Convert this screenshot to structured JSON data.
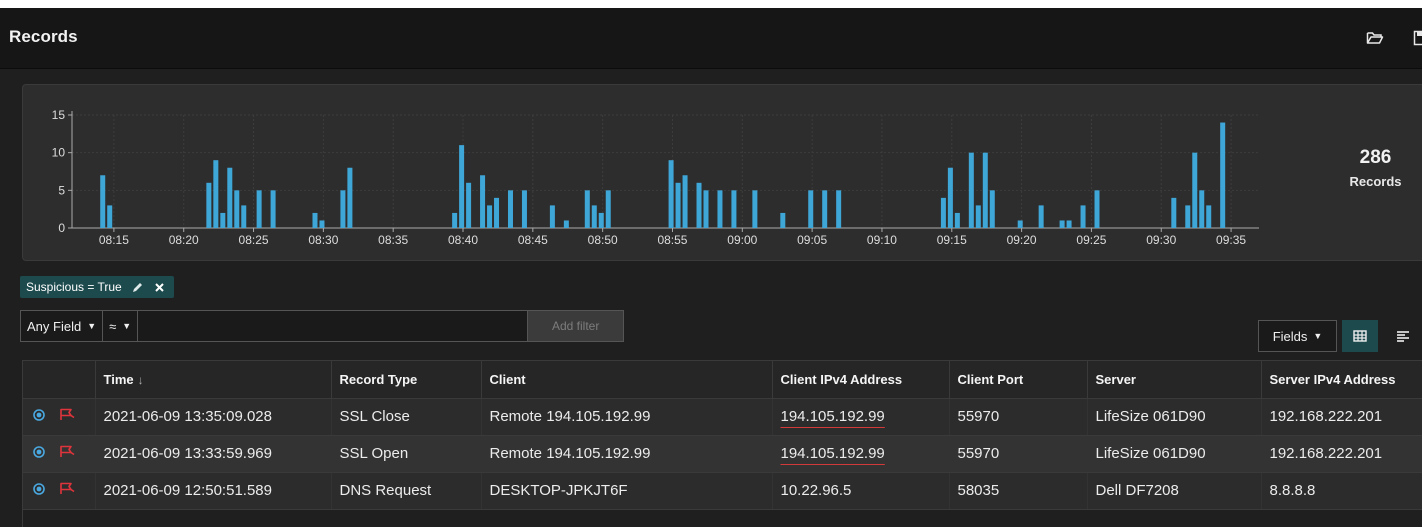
{
  "header": {
    "title": "Records",
    "icons": [
      "folder-open-icon",
      "save-icon"
    ]
  },
  "summary": {
    "count": "286",
    "label": "Records"
  },
  "chart_data": {
    "type": "bar",
    "ylim": [
      0,
      15
    ],
    "yticks": [
      "0",
      "5",
      "10",
      "15"
    ],
    "xticks": [
      "08:15",
      "08:20",
      "08:25",
      "08:30",
      "08:35",
      "08:40",
      "08:45",
      "08:50",
      "08:55",
      "09:00",
      "09:05",
      "09:10",
      "09:15",
      "09:20",
      "09:25",
      "09:30",
      "09:35"
    ],
    "x_unit": "minute",
    "x_start": "08:12",
    "x_end": "09:37",
    "bars": [
      {
        "t": "08:14.2",
        "v": 7
      },
      {
        "t": "08:14.7",
        "v": 3
      },
      {
        "t": "08:21.8",
        "v": 6
      },
      {
        "t": "08:22.3",
        "v": 9
      },
      {
        "t": "08:22.8",
        "v": 2
      },
      {
        "t": "08:23.3",
        "v": 8
      },
      {
        "t": "08:23.8",
        "v": 5
      },
      {
        "t": "08:24.3",
        "v": 3
      },
      {
        "t": "08:25.4",
        "v": 5
      },
      {
        "t": "08:26.4",
        "v": 5
      },
      {
        "t": "08:29.4",
        "v": 2
      },
      {
        "t": "08:29.9",
        "v": 1
      },
      {
        "t": "08:31.4",
        "v": 5
      },
      {
        "t": "08:31.9",
        "v": 8
      },
      {
        "t": "08:39.4",
        "v": 2
      },
      {
        "t": "08:39.9",
        "v": 11
      },
      {
        "t": "08:40.4",
        "v": 6
      },
      {
        "t": "08:41.4",
        "v": 7
      },
      {
        "t": "08:41.9",
        "v": 3
      },
      {
        "t": "08:42.4",
        "v": 4
      },
      {
        "t": "08:43.4",
        "v": 5
      },
      {
        "t": "08:44.4",
        "v": 5
      },
      {
        "t": "08:46.4",
        "v": 3
      },
      {
        "t": "08:47.4",
        "v": 1
      },
      {
        "t": "08:48.9",
        "v": 5
      },
      {
        "t": "08:49.4",
        "v": 3
      },
      {
        "t": "08:49.9",
        "v": 2
      },
      {
        "t": "08:50.4",
        "v": 5
      },
      {
        "t": "08:54.9",
        "v": 9
      },
      {
        "t": "08:55.4",
        "v": 6
      },
      {
        "t": "08:55.9",
        "v": 7
      },
      {
        "t": "08:56.9",
        "v": 6
      },
      {
        "t": "08:57.4",
        "v": 5
      },
      {
        "t": "08:58.4",
        "v": 5
      },
      {
        "t": "08:59.4",
        "v": 5
      },
      {
        "t": "09:00.9",
        "v": 5
      },
      {
        "t": "09:02.9",
        "v": 2
      },
      {
        "t": "09:04.9",
        "v": 5
      },
      {
        "t": "09:05.9",
        "v": 5
      },
      {
        "t": "09:06.9",
        "v": 5
      },
      {
        "t": "09:14.4",
        "v": 4
      },
      {
        "t": "09:14.9",
        "v": 8
      },
      {
        "t": "09:15.4",
        "v": 2
      },
      {
        "t": "09:16.4",
        "v": 10
      },
      {
        "t": "09:16.9",
        "v": 3
      },
      {
        "t": "09:17.4",
        "v": 10
      },
      {
        "t": "09:17.9",
        "v": 5
      },
      {
        "t": "09:19.9",
        "v": 1
      },
      {
        "t": "09:21.4",
        "v": 3
      },
      {
        "t": "09:22.9",
        "v": 1
      },
      {
        "t": "09:23.4",
        "v": 1
      },
      {
        "t": "09:24.4",
        "v": 3
      },
      {
        "t": "09:25.4",
        "v": 5
      },
      {
        "t": "09:30.9",
        "v": 4
      },
      {
        "t": "09:31.9",
        "v": 3
      },
      {
        "t": "09:32.4",
        "v": 10
      },
      {
        "t": "09:32.9",
        "v": 5
      },
      {
        "t": "09:33.4",
        "v": 3
      },
      {
        "t": "09:34.4",
        "v": 14
      }
    ],
    "bar_color": "#3fa6d8",
    "grid": true
  },
  "filter_tag": {
    "label": "Suspicious = True",
    "edit_icon": "pencil-icon",
    "remove_icon": "close-icon",
    "color": "#1d4a4d"
  },
  "filter_bar": {
    "field_select": "Any Field",
    "operator_select": "≈",
    "input_value": "",
    "add_button": "Add filter"
  },
  "toolbar": {
    "fields_button": "Fields",
    "grid_view_icon": "table-grid-icon",
    "list_view_icon": "list-icon",
    "accent": "#1d4a4d"
  },
  "table": {
    "columns": [
      "",
      "Time",
      "Record Type",
      "Client",
      "Client IPv4 Address",
      "Client Port",
      "Server",
      "Server IPv4 Address"
    ],
    "sort_icon": "↓",
    "rows": [
      {
        "time": "2021-06-09 13:35:09.028",
        "record_type": "SSL Close",
        "client": "Remote 194.105.192.99",
        "client_ip": "194.105.192.99",
        "client_port": "55970",
        "server": "LifeSize 061D90",
        "server_ip": "192.168.222.201"
      },
      {
        "time": "2021-06-09 13:33:59.969",
        "record_type": "SSL Open",
        "client": "Remote 194.105.192.99",
        "client_ip": "194.105.192.99",
        "client_port": "55970",
        "server": "LifeSize 061D90",
        "server_ip": "192.168.222.201"
      },
      {
        "time": "2021-06-09 12:50:51.589",
        "record_type": "DNS Request",
        "client": "DESKTOP-JPKJT6F",
        "client_ip": "10.22.96.5",
        "client_port": "58035",
        "server": "Dell DF7208",
        "server_ip": "8.8.8.8"
      }
    ]
  }
}
